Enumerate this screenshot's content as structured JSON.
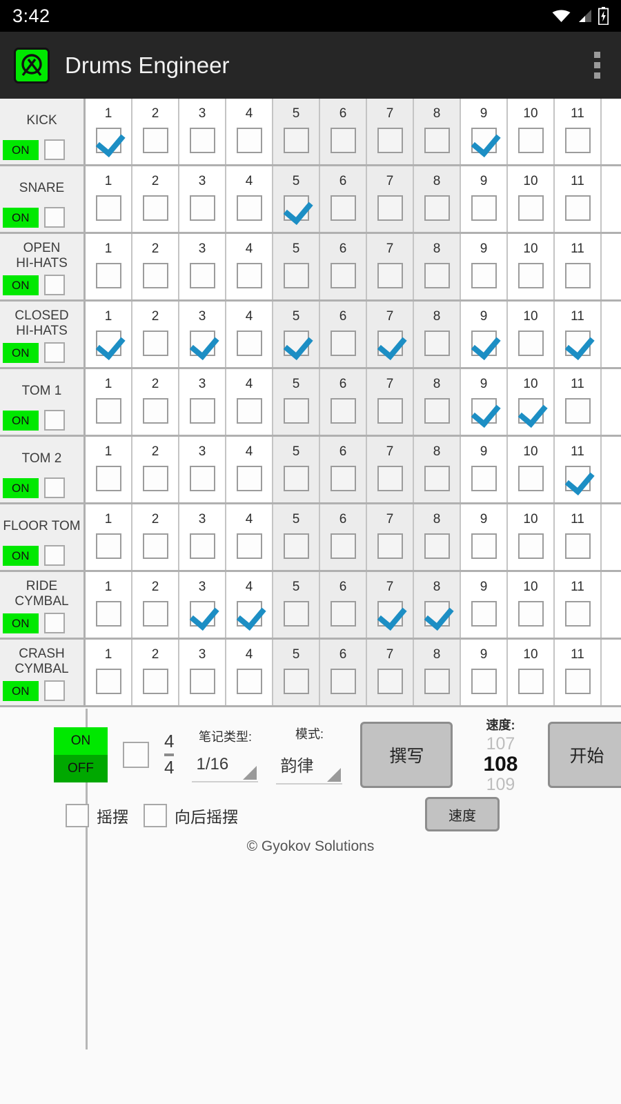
{
  "statusbar": {
    "clock": "3:42",
    "icons": [
      "wifi-icon",
      "signal-icon",
      "battery-charging-icon"
    ]
  },
  "appbar": {
    "title": "Drums Engineer",
    "icon": "drums-app-icon",
    "overflow": "overflow-menu-icon"
  },
  "grid": {
    "step_numbers": [
      "1",
      "2",
      "3",
      "4",
      "5",
      "6",
      "7",
      "8",
      "9",
      "10",
      "11"
    ],
    "banded_steps": [
      5,
      6,
      7,
      8
    ],
    "on_label": "ON",
    "rows": [
      {
        "label": "KICK",
        "on": "ON",
        "steps": [
          true,
          false,
          false,
          false,
          false,
          false,
          false,
          false,
          true,
          false,
          false
        ]
      },
      {
        "label": "SNARE",
        "on": "ON",
        "steps": [
          false,
          false,
          false,
          false,
          true,
          false,
          false,
          false,
          false,
          false,
          false
        ]
      },
      {
        "label": "OPEN\nHI-HATS",
        "on": "ON",
        "steps": [
          false,
          false,
          false,
          false,
          false,
          false,
          false,
          false,
          false,
          false,
          false
        ]
      },
      {
        "label": "CLOSED\nHI-HATS",
        "on": "ON",
        "steps": [
          true,
          false,
          true,
          false,
          true,
          false,
          true,
          false,
          true,
          false,
          true
        ]
      },
      {
        "label": "TOM 1",
        "on": "ON",
        "steps": [
          false,
          false,
          false,
          false,
          false,
          false,
          false,
          false,
          true,
          true,
          false
        ]
      },
      {
        "label": "TOM 2",
        "on": "ON",
        "steps": [
          false,
          false,
          false,
          false,
          false,
          false,
          false,
          false,
          false,
          false,
          true
        ]
      },
      {
        "label": "FLOOR TOM",
        "on": "ON",
        "steps": [
          false,
          false,
          false,
          false,
          false,
          false,
          false,
          false,
          false,
          false,
          false
        ]
      },
      {
        "label": "RIDE\nCYMBAL",
        "on": "ON",
        "steps": [
          false,
          false,
          true,
          true,
          false,
          false,
          true,
          true,
          false,
          false,
          false
        ]
      },
      {
        "label": "CRASH\nCYMBAL",
        "on": "ON",
        "steps": [
          false,
          false,
          false,
          false,
          false,
          false,
          false,
          false,
          false,
          false,
          false
        ]
      }
    ]
  },
  "controls": {
    "toggle_on": "ON",
    "toggle_off": "OFF",
    "time_signature": {
      "numerator": "4",
      "denominator": "4"
    },
    "note_type": {
      "label": "笔记类型:",
      "value": "1/16"
    },
    "mode": {
      "label": "模式:",
      "value": "韵律"
    },
    "compose_button": "撰写",
    "start_button": "开始",
    "tempo": {
      "label": "速度:",
      "prev": "107",
      "current": "108",
      "next": "109"
    },
    "speed_button": "速度",
    "swing_label": "摇摆",
    "backward_swing_label": "向后摇摆"
  },
  "footer": {
    "copyright": "© Gyokov Solutions"
  },
  "colors": {
    "accent_green": "#00E800",
    "dark_green": "#00A800",
    "check_blue": "#1c8ec4",
    "appbar": "#262626"
  }
}
